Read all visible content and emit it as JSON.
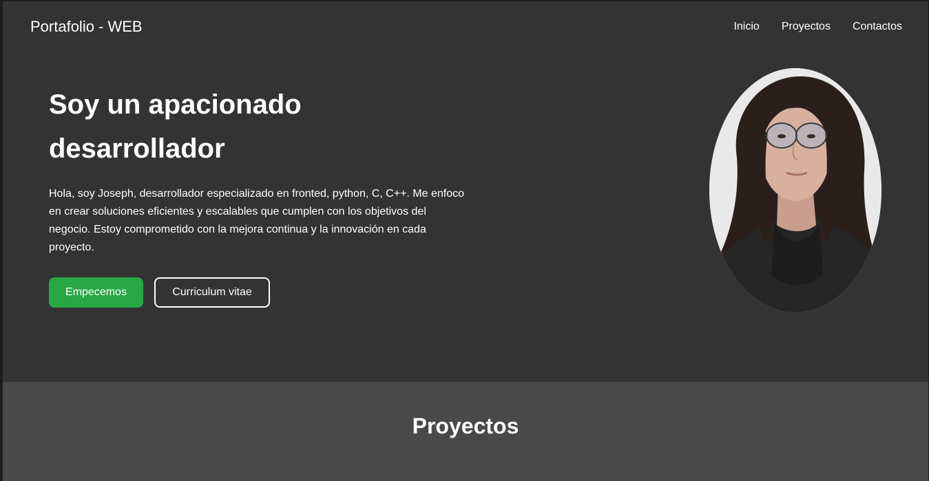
{
  "header": {
    "brand": "Portafolio - WEB",
    "nav": [
      "Inicio",
      "Proyectos",
      "Contactos"
    ]
  },
  "hero": {
    "title": "Soy un apacionado desarrollador",
    "description": "Hola, soy Joseph, desarrollador especializado en fronted, python, C, C++. Me enfoco en crear soluciones eficientes y escalables que cumplen con los objetivos del negocio. Estoy comprometido con la mejora continua y la innovación en cada proyecto.",
    "primary_button": "Empecemos",
    "secondary_button": "Curriculum vitae"
  },
  "projects": {
    "title": "Proyectos"
  },
  "colors": {
    "background": "#333333",
    "section_bg": "#494949",
    "accent": "#28a745",
    "text": "#ffffff"
  }
}
